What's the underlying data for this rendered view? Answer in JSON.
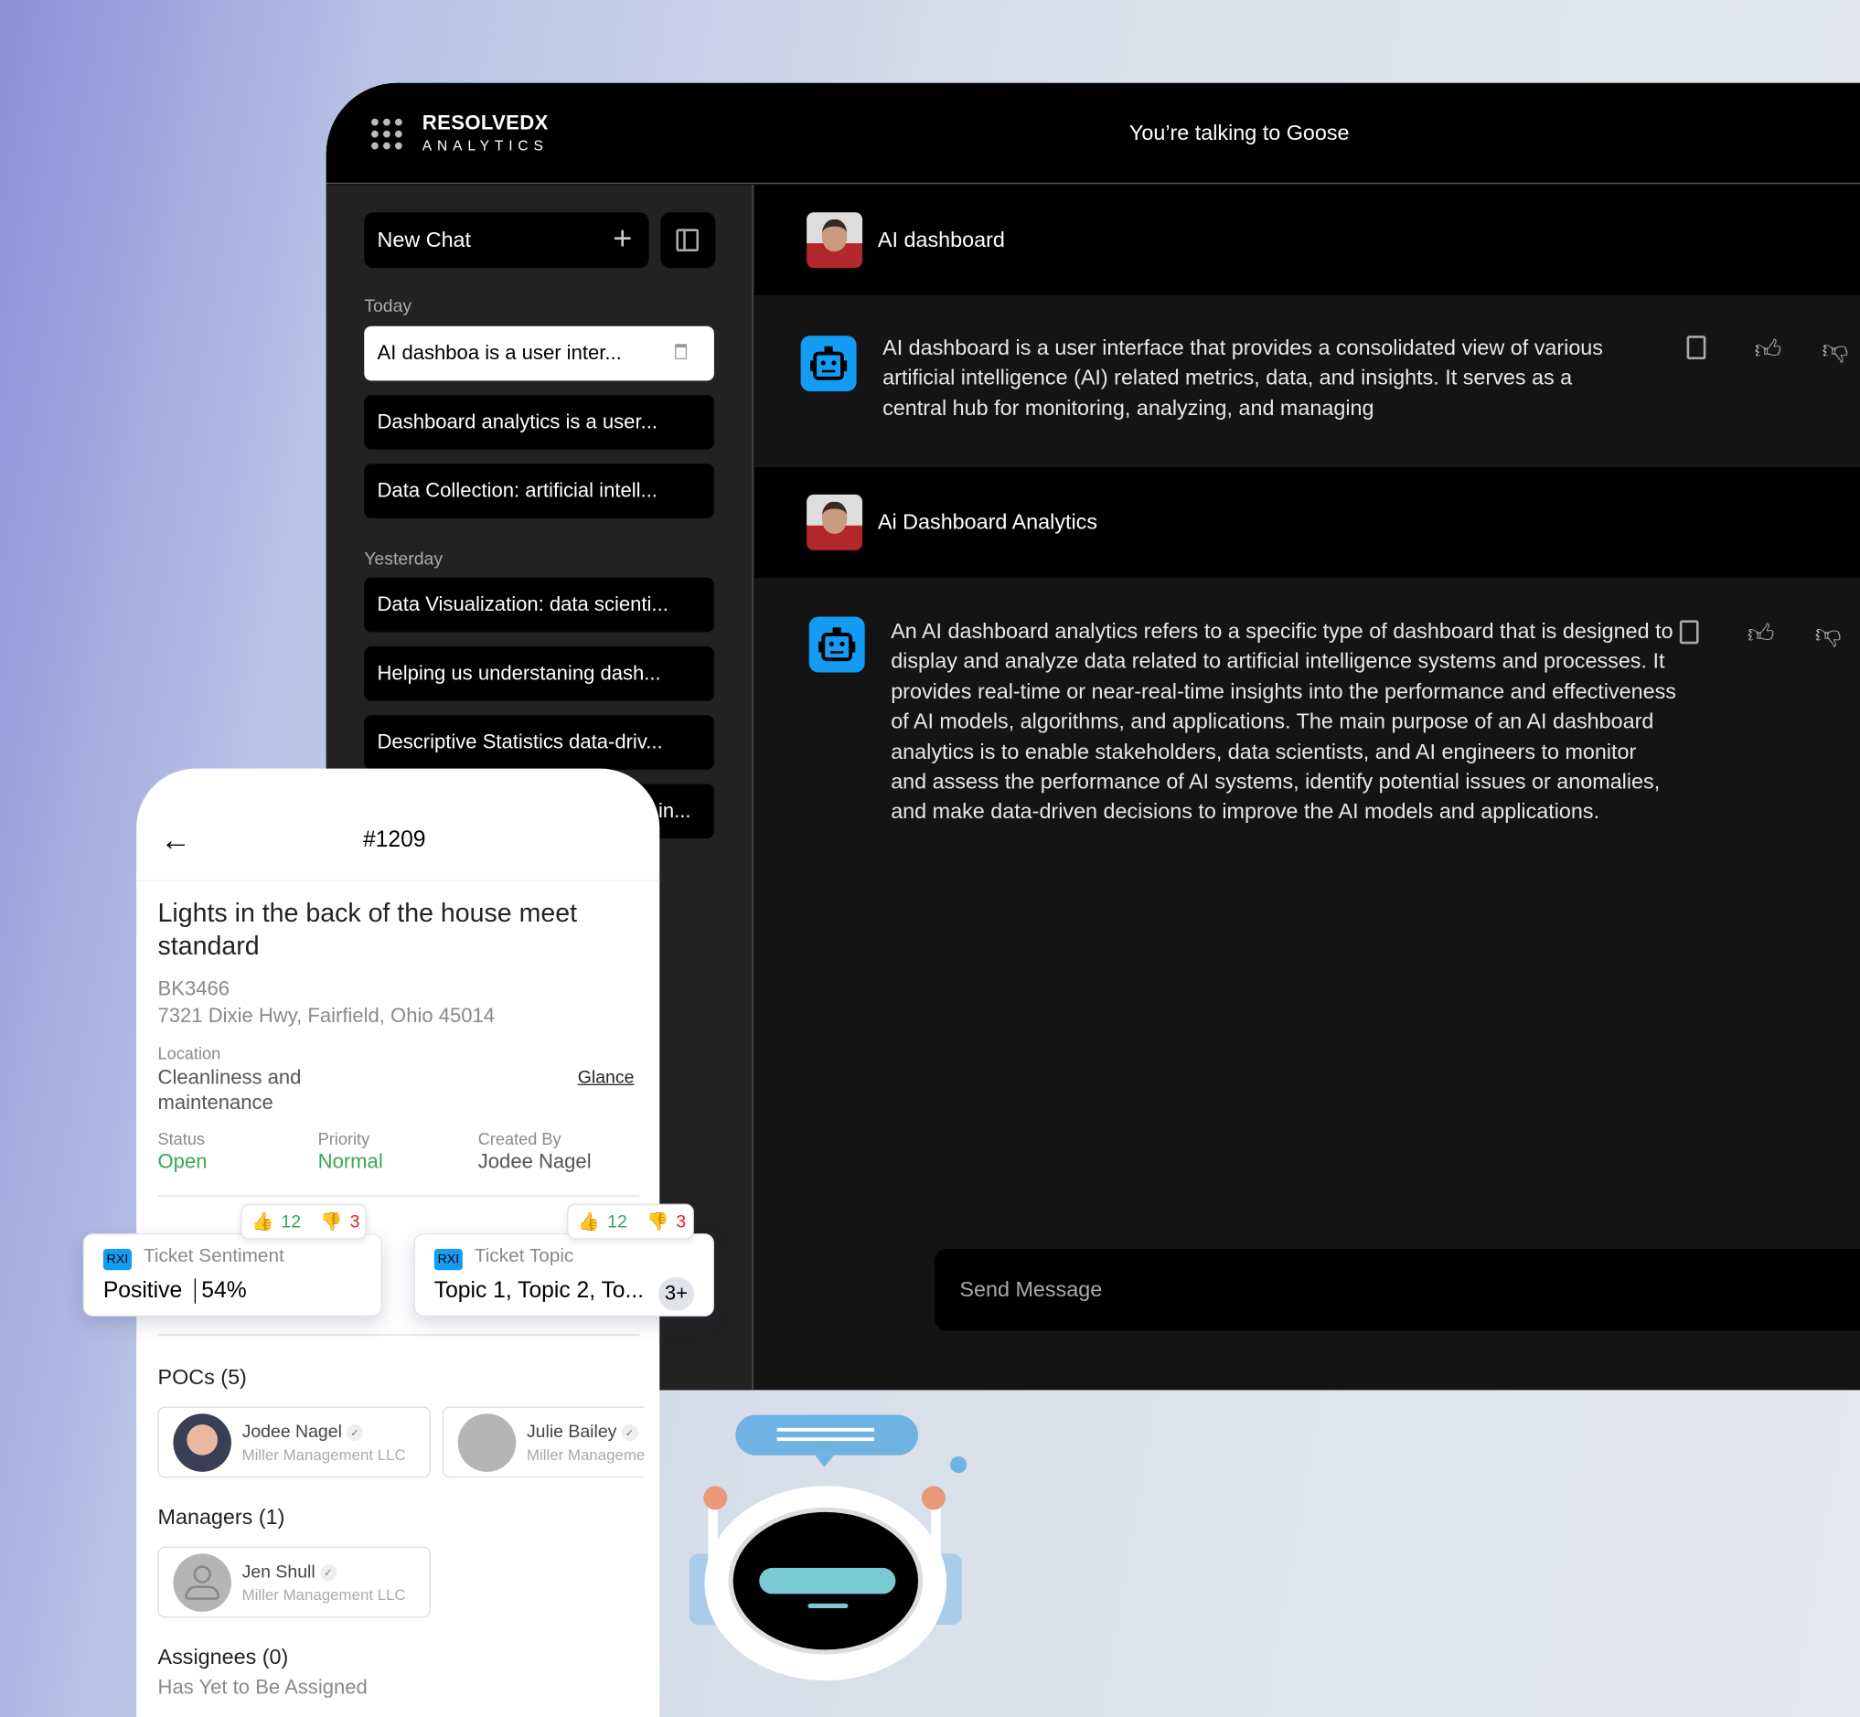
{
  "brand": {
    "name": "RESOLVEDX",
    "sub": "ANALYTICS"
  },
  "header": {
    "title": "You’re talking to Goose"
  },
  "sidebar": {
    "new_chat": "New Chat",
    "today": "Today",
    "yesterday": "Yesterday",
    "today_items": [
      "AI dashboa is a user inter...",
      "Dashboard analytics is a user...",
      "Data Collection: artificial intell..."
    ],
    "yesterday_items": [
      "Data Visualization: data scienti...",
      "Helping us understaning dash...",
      "Descriptive Statistics data-driv...",
      "in..."
    ]
  },
  "chat": [
    {
      "role": "user",
      "text": "AI dashboard"
    },
    {
      "role": "bot",
      "text": "AI dashboard is a user interface that provides a consolidated view of various artificial intelligence (AI) related metrics, data, and insights. It serves as a central hub for monitoring, analyzing, and managing"
    },
    {
      "role": "user",
      "text": "Ai Dashboard Analytics"
    },
    {
      "role": "bot",
      "text": "An AI dashboard analytics refers to a specific type of dashboard that is designed to display and analyze data related to artificial intelligence systems and processes. It provides real-time or near-real-time insights into the performance and effectiveness of AI models, algorithms, and applications. The main purpose of an AI dashboard analytics is to enable stakeholders, data scientists, and AI engineers to monitor and assess the performance of AI systems, identify potential issues or anomalies, and make data-driven decisions to improve the AI models and applications."
    }
  ],
  "input": {
    "placeholder": "Send Message"
  },
  "ticket": {
    "number": "#1209",
    "title": "Lights in the back of the house meet standard",
    "code": "BK3466",
    "address": "7321 Dixie Hwy, Fairfield, Ohio 45014",
    "location_label": "Location",
    "location": "Cleanliness and maintenance",
    "glance": "Glance",
    "status_label": "Status",
    "status": "Open",
    "priority_label": "Priority",
    "priority": "Normal",
    "created_label": "Created By",
    "created": "Jodee Nagel",
    "sentiment": {
      "badge": "RXI",
      "label": "Ticket Sentiment",
      "value": "Positive",
      "percent": "54%",
      "up": "12",
      "down": "3"
    },
    "topic": {
      "badge": "RXI",
      "label": "Ticket Topic",
      "value": "Topic 1, Topic 2, To...",
      "more": "3+",
      "up": "12",
      "down": "3"
    },
    "pocs_label": "POCs (5)",
    "pocs": [
      {
        "name": "Jodee Nagel",
        "org": "Miller Management LLC"
      },
      {
        "name": "Julie Bailey",
        "org": "Miller Management LLC"
      }
    ],
    "managers_label": "Managers (1)",
    "managers": [
      {
        "name": "Jen Shull",
        "org": "Miller Management LLC"
      }
    ],
    "assignees_label": "Assignees (0)",
    "assignees_empty": "Has Yet to Be Assigned"
  },
  "colors": {
    "accent": "#149cf5",
    "green": "#3aa655",
    "red": "#e02424"
  }
}
